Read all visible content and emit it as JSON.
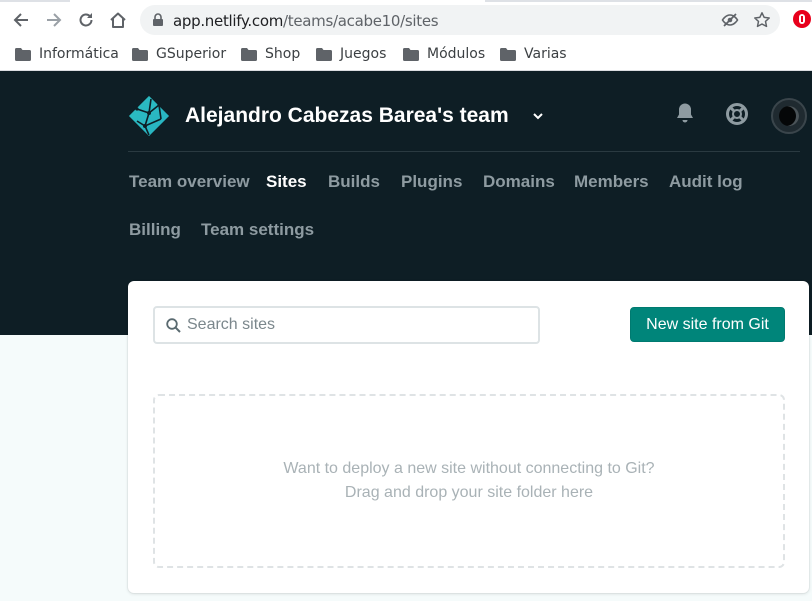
{
  "browser": {
    "url_host": "app.netlify.com",
    "url_path": "/teams/acabe10/sites",
    "bookmarks": [
      {
        "label": "Informática"
      },
      {
        "label": "GSuperior"
      },
      {
        "label": "Shop"
      },
      {
        "label": "Juegos"
      },
      {
        "label": "Módulos"
      },
      {
        "label": "Varias"
      }
    ]
  },
  "header": {
    "team_name": "Alejandro Cabezas Barea's team",
    "nav": [
      {
        "label": "Team overview",
        "active": false
      },
      {
        "label": "Sites",
        "active": true
      },
      {
        "label": "Builds",
        "active": false
      },
      {
        "label": "Plugins",
        "active": false
      },
      {
        "label": "Domains",
        "active": false
      },
      {
        "label": "Members",
        "active": false
      },
      {
        "label": "Audit log",
        "active": false
      },
      {
        "label": "Billing",
        "active": false
      },
      {
        "label": "Team settings",
        "active": false
      }
    ]
  },
  "main": {
    "search_placeholder": "Search sites",
    "search_value": "",
    "new_site_label": "New site from Git",
    "dropzone_line1": "Want to deploy a new site without connecting to Git?",
    "dropzone_line2": "Drag and drop your site folder here"
  },
  "colors": {
    "header_bg": "#0e1e25",
    "brand_teal": "#00857a",
    "page_bg": "#f5fbfb"
  },
  "icons": [
    "back-icon",
    "forward-icon",
    "reload-icon",
    "home-icon",
    "lock-icon",
    "eye-off-icon",
    "star-icon",
    "extension-icon",
    "folder-icon",
    "netlify-logo-icon",
    "chevron-down-icon",
    "bell-icon",
    "lifebuoy-icon",
    "search-icon"
  ]
}
